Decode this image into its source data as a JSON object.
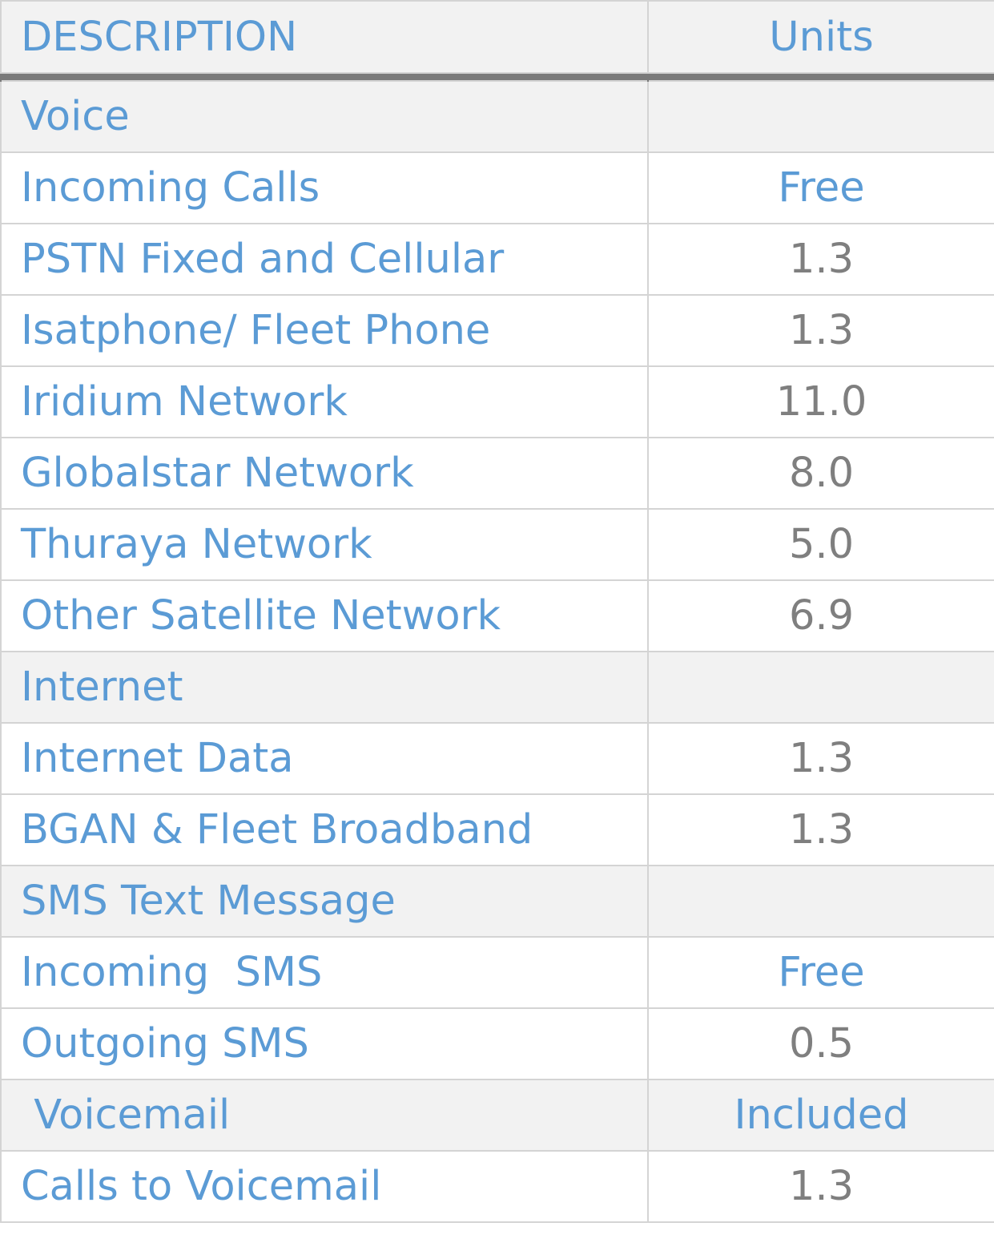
{
  "table": {
    "headers": {
      "description": "DESCRIPTION",
      "units": "Units"
    },
    "rows": [
      {
        "type": "section",
        "description": "Voice",
        "units": ""
      },
      {
        "type": "item",
        "description": "Incoming Calls",
        "units": "Free"
      },
      {
        "type": "item",
        "description": "PSTN Fixed and Cellular",
        "units": "1.3"
      },
      {
        "type": "item",
        "description": "Isatphone/ Fleet Phone",
        "units": "1.3"
      },
      {
        "type": "item",
        "description": "Iridium Network",
        "units": "11.0"
      },
      {
        "type": "item",
        "description": "Globalstar Network",
        "units": "8.0"
      },
      {
        "type": "item",
        "description": "Thuraya Network",
        "units": "5.0"
      },
      {
        "type": "item",
        "description": "Other Satellite Network",
        "units": "6.9"
      },
      {
        "type": "section",
        "description": "Internet",
        "units": ""
      },
      {
        "type": "item",
        "description": "Internet Data",
        "units": "1.3"
      },
      {
        "type": "item",
        "description": "BGAN & Fleet Broadband",
        "units": "1.3"
      },
      {
        "type": "section",
        "description": "SMS Text Message",
        "units": ""
      },
      {
        "type": "item",
        "description": "Incoming  SMS",
        "units": "Free"
      },
      {
        "type": "item",
        "description": "Outgoing SMS",
        "units": "0.5"
      },
      {
        "type": "section",
        "description": " Voicemail",
        "units": "Included"
      },
      {
        "type": "item",
        "description": "Calls to Voicemail",
        "units": "1.3"
      }
    ]
  },
  "colors": {
    "accent_text": "#5b9bd5",
    "value_text": "#7f7f7f",
    "section_bg": "#f2f2f2",
    "grid": "#d4d4d4",
    "header_divider": "#7a7a7a"
  }
}
